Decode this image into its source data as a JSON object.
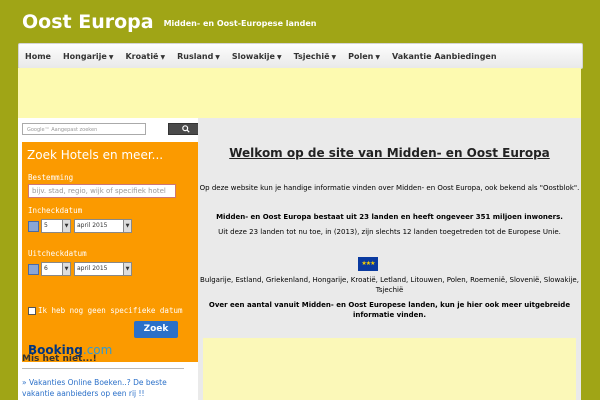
{
  "site": {
    "title": "Oost Europa",
    "subtitle": "Midden- en Oost-Europese landen"
  },
  "nav": [
    {
      "label": "Home",
      "dropdown": false
    },
    {
      "label": "Hongarije",
      "dropdown": true
    },
    {
      "label": "Kroatië",
      "dropdown": true
    },
    {
      "label": "Rusland",
      "dropdown": true
    },
    {
      "label": "Slowakije",
      "dropdown": true
    },
    {
      "label": "Tsjechië",
      "dropdown": true
    },
    {
      "label": "Polen",
      "dropdown": true
    },
    {
      "label": "Vakantie Aanbiedingen",
      "dropdown": false
    }
  ],
  "search": {
    "placeholder": "Google™ Aangepast zoeken",
    "button_icon": "search-icon"
  },
  "booking": {
    "heading": "Zoek Hotels en meer...",
    "destination_label": "Bestemming",
    "destination_placeholder": "bijv. stad, regio, wijk of specifiek hotel",
    "checkin_label": "Incheckdatum",
    "checkout_label": "Uitcheckdatum",
    "checkin_day": "5",
    "checkin_month": "april 2015",
    "checkout_day": "6",
    "checkout_month": "april 2015",
    "no_dates_label": "Ik heb nog geen specifieke datum",
    "submit_label": "Zoek",
    "brand_main": "Booking",
    "brand_suffix": ".com"
  },
  "sidebar": {
    "heading": "Mis het niet...!",
    "link": "» Vakanties Online Boeken..? De beste vakantie aanbieders op een rij !!"
  },
  "content": {
    "welcome": "Welkom op de site van Midden- en Oost Europa",
    "intro": "Op deze website kun je handige informatie vinden over Midden- en Oost Europa, ook bekend als \"Oostblok\".",
    "stats": "Midden- en Oost Europa bestaat uit 23 landen en heeft ongeveer 351 miljoen inwoners.",
    "eu": "Uit deze 23 landen tot nu toe, in (2013), zijn slechts 12 landen toegetreden tot de Europese Unie.",
    "countries": "Bulgarije, Estland, Griekenland, Hongarije, Kroatië, Letland, Litouwen, Polen, Roemenië, Slovenië, Slowakije, Tsjechië",
    "outro": "Over een aantal vanuit Midden- en Oost Europese landen, kun je hier ook meer uitgebreide informatie vinden."
  },
  "colors": {
    "page_bg": "#a0a516",
    "booking_bg": "#fb9a00",
    "ad_bg": "#fdfab0",
    "link": "#2b70c9"
  }
}
